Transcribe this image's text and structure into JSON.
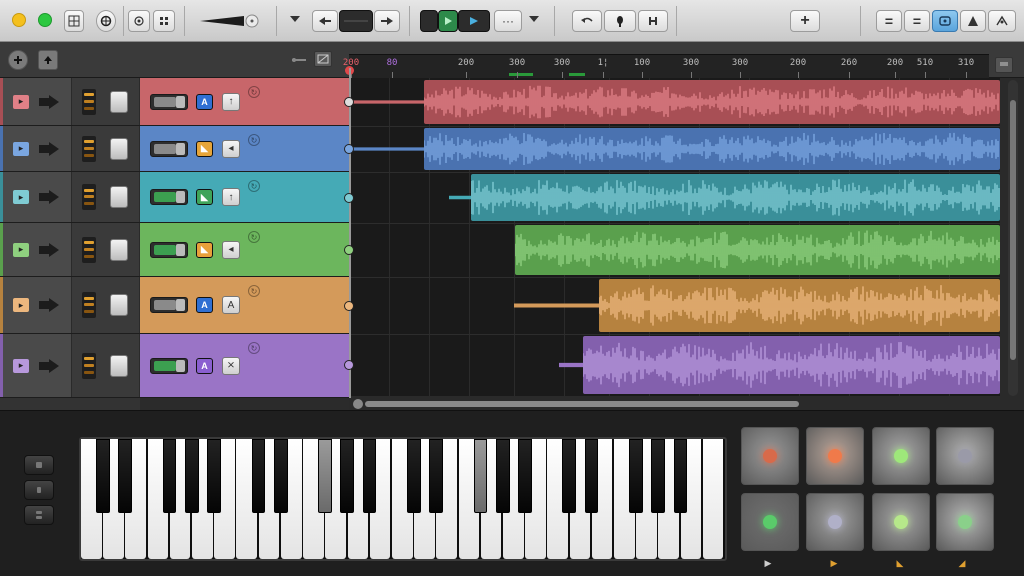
{
  "window": {
    "traffic_lights": {
      "close": "#f4c01e",
      "minimize": "#2cc840",
      "maximize": "#5a5a5a"
    }
  },
  "toolbar": {
    "buttons": [
      {
        "name": "browser-button",
        "icon": "browser-icon"
      },
      {
        "name": "smart-controls-button",
        "icon": "smart-controls-icon"
      },
      {
        "name": "loop-browser-button",
        "icon": "loop-icon"
      },
      {
        "name": "editor-button",
        "icon": "editor-icon"
      },
      {
        "name": "master-volume",
        "icon": "volume-slider"
      },
      {
        "name": "rewind-button",
        "icon": "rewind-icon"
      },
      {
        "name": "display-field",
        "icon": "lcd-display"
      },
      {
        "name": "forward-button",
        "icon": "forward-icon"
      },
      {
        "name": "play-button",
        "icon": "play-icon"
      },
      {
        "name": "cycle-button",
        "icon": "cycle-icon"
      },
      {
        "name": "more-button",
        "label": "···"
      },
      {
        "name": "undo-button",
        "icon": "undo-icon"
      },
      {
        "name": "tuner-button",
        "icon": "tuner-icon"
      },
      {
        "name": "count-in-button",
        "icon": "count-in-icon"
      },
      {
        "name": "add-track-button",
        "label": "+"
      },
      {
        "name": "list-editor-button",
        "label": "="
      },
      {
        "name": "notepad-button",
        "label": "="
      },
      {
        "name": "loops-button",
        "icon": "loops-icon"
      },
      {
        "name": "media-button",
        "icon": "media-icon"
      },
      {
        "name": "library-button",
        "icon": "library-icon"
      }
    ]
  },
  "ruler": {
    "ticks": [
      "200",
      "80",
      "200",
      "300",
      "300",
      "1¦",
      "100",
      "300",
      "300",
      "200",
      "260",
      "200",
      "510",
      "310"
    ]
  },
  "tracks": [
    {
      "name": "track-1",
      "color": "#c8666a",
      "strip": "#a84f55",
      "icon_bg": "#e08087",
      "fader_fill": "#8a8a8a",
      "badge_bg": "#2f6fd2",
      "badge_text": "A",
      "btn_text": "↑"
    },
    {
      "name": "track-2",
      "color": "#5b86c6",
      "strip": "#4a72b0",
      "icon_bg": "#7aa6e0",
      "fader_fill": "#8a8a8a",
      "badge_bg": "#e6a53a",
      "badge_text": "◣",
      "btn_text": "◂"
    },
    {
      "name": "track-3",
      "color": "#45aab6",
      "strip": "#3a8f99",
      "icon_bg": "#7fcbd3",
      "fader_fill": "#3c9f50",
      "badge_bg": "#3fa45a",
      "badge_text": "◣",
      "btn_text": "↑"
    },
    {
      "name": "track-4",
      "color": "#6cb65d",
      "strip": "#5aa04d",
      "icon_bg": "#8fd07f",
      "fader_fill": "#3c9f50",
      "badge_bg": "#e8a03a",
      "badge_text": "◣",
      "btn_text": "◂"
    },
    {
      "name": "track-5",
      "color": "#d49a5a",
      "strip": "#b6823f",
      "icon_bg": "#ecb77e",
      "fader_fill": "#8a8a8a",
      "badge_bg": "#2f6fd2",
      "badge_text": "A",
      "btn_text": "A"
    },
    {
      "name": "track-6",
      "color": "#9a74c6",
      "strip": "#8360ad",
      "icon_bg": "#b798dc",
      "fader_fill": "#3c9f50",
      "badge_bg": "#8a5fd0",
      "badge_text": "A",
      "btn_text": "⨯"
    }
  ],
  "pads": {
    "labels": [
      "▶",
      "▶",
      "◣",
      "◢"
    ]
  }
}
